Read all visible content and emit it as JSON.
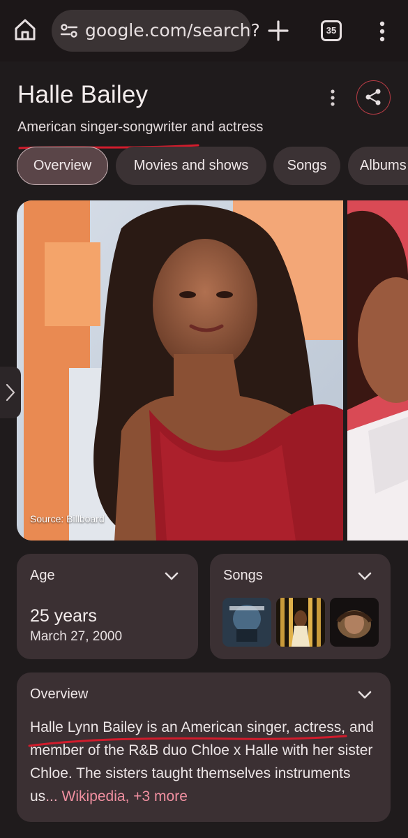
{
  "browser": {
    "url": "google.com/search?",
    "tab_count": "35",
    "icons": [
      "home-icon",
      "site-settings-icon",
      "plus-icon",
      "tabs-icon",
      "overflow-menu-icon"
    ]
  },
  "knowledge_panel": {
    "title": "Halle Bailey",
    "subtitle": "American singer-songwriter and actress",
    "chips": [
      {
        "label": "Overview",
        "active": true
      },
      {
        "label": "Movies and shows",
        "active": false
      },
      {
        "label": "Songs",
        "active": false
      },
      {
        "label": "Albums",
        "active": false
      }
    ],
    "image_source": "Source: Billboard",
    "age_card": {
      "title": "Age",
      "value": "25 years",
      "date": "March 27, 2000"
    },
    "songs_card": {
      "title": "Songs"
    },
    "overview_card": {
      "title": "Overview",
      "text_start": "Halle Lynn Bailey is an American singer, actress, and member of the R&B duo Chloe x Halle with her sister Chloe. The sisters taught themselves instruments us",
      "ellipsis": "...",
      "link": "Wikipedia,",
      "more": "+3 more"
    }
  },
  "colors": {
    "background": "#1f1b1c",
    "card": "#3b3033",
    "accent_red": "#d11c2c",
    "link_pink": "#f08fa0"
  }
}
